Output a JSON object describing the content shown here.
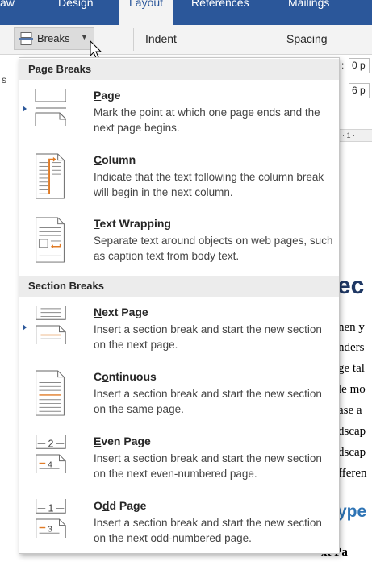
{
  "ribbon": {
    "tabs": [
      "aw",
      "Design",
      "Layout",
      "References",
      "Mailings"
    ],
    "active_tab": "Layout",
    "breaks_label": "Breaks",
    "indent_label": "Indent",
    "spacing_label": "Spacing",
    "left_edge_text": "s",
    "spacing_before": "0 p",
    "spacing_after": "6 p",
    "ruler_text": "· 1 ·"
  },
  "menu": {
    "page_breaks_header": "Page Breaks",
    "section_breaks_header": "Section Breaks",
    "page_breaks": [
      {
        "title": "Page",
        "accel": "P",
        "rest": "age",
        "desc": "Mark the point at which one page ends and the next page begins.",
        "icon": "page-break-icon"
      },
      {
        "title": "Column",
        "accel": "C",
        "rest": "olumn",
        "desc": "Indicate that the text following the column break will begin in the next column.",
        "icon": "column-break-icon"
      },
      {
        "title": "Text Wrapping",
        "accel": "T",
        "rest": "ext Wrapping",
        "desc": "Separate text around objects on web pages, such as caption text from body text.",
        "icon": "text-wrapping-break-icon"
      }
    ],
    "section_breaks": [
      {
        "title": "Next Page",
        "accel": "N",
        "rest": "ext Page",
        "desc": "Insert a section break and start the new section on the next page.",
        "icon": "next-page-break-icon"
      },
      {
        "title": "Continuous",
        "accel": "o",
        "pre": "C",
        "rest": "ntinuous",
        "desc": "Insert a section break and start the new section on the same page.",
        "icon": "continuous-break-icon"
      },
      {
        "title": "Even Page",
        "accel": "E",
        "rest": "ven Page",
        "desc": "Insert a section break and start the new section on the next even-numbered page.",
        "icon": "even-page-break-icon"
      },
      {
        "title": "Odd Page",
        "accel": "d",
        "pre": "O",
        "rest": "d Page",
        "desc": "Insert a section break and start the new section on the next odd-numbered page.",
        "icon": "odd-page-break-icon"
      }
    ]
  },
  "document": {
    "heading": "ec",
    "lines": [
      "nen y",
      "nders",
      "ge tal",
      "le mo",
      "ase a",
      "dscap",
      "dscap",
      "fferen"
    ],
    "heading2": "ype",
    "bottom_text": "xt Pa"
  },
  "icon_numbers": {
    "even": "2",
    "even_lower": "4",
    "odd": "1",
    "odd_lower": "3"
  },
  "colors": {
    "ribbon_blue": "#2b579a",
    "section_header_bg": "#ececec",
    "marker": "#2b579a",
    "accent_orange": "#e07b26"
  }
}
